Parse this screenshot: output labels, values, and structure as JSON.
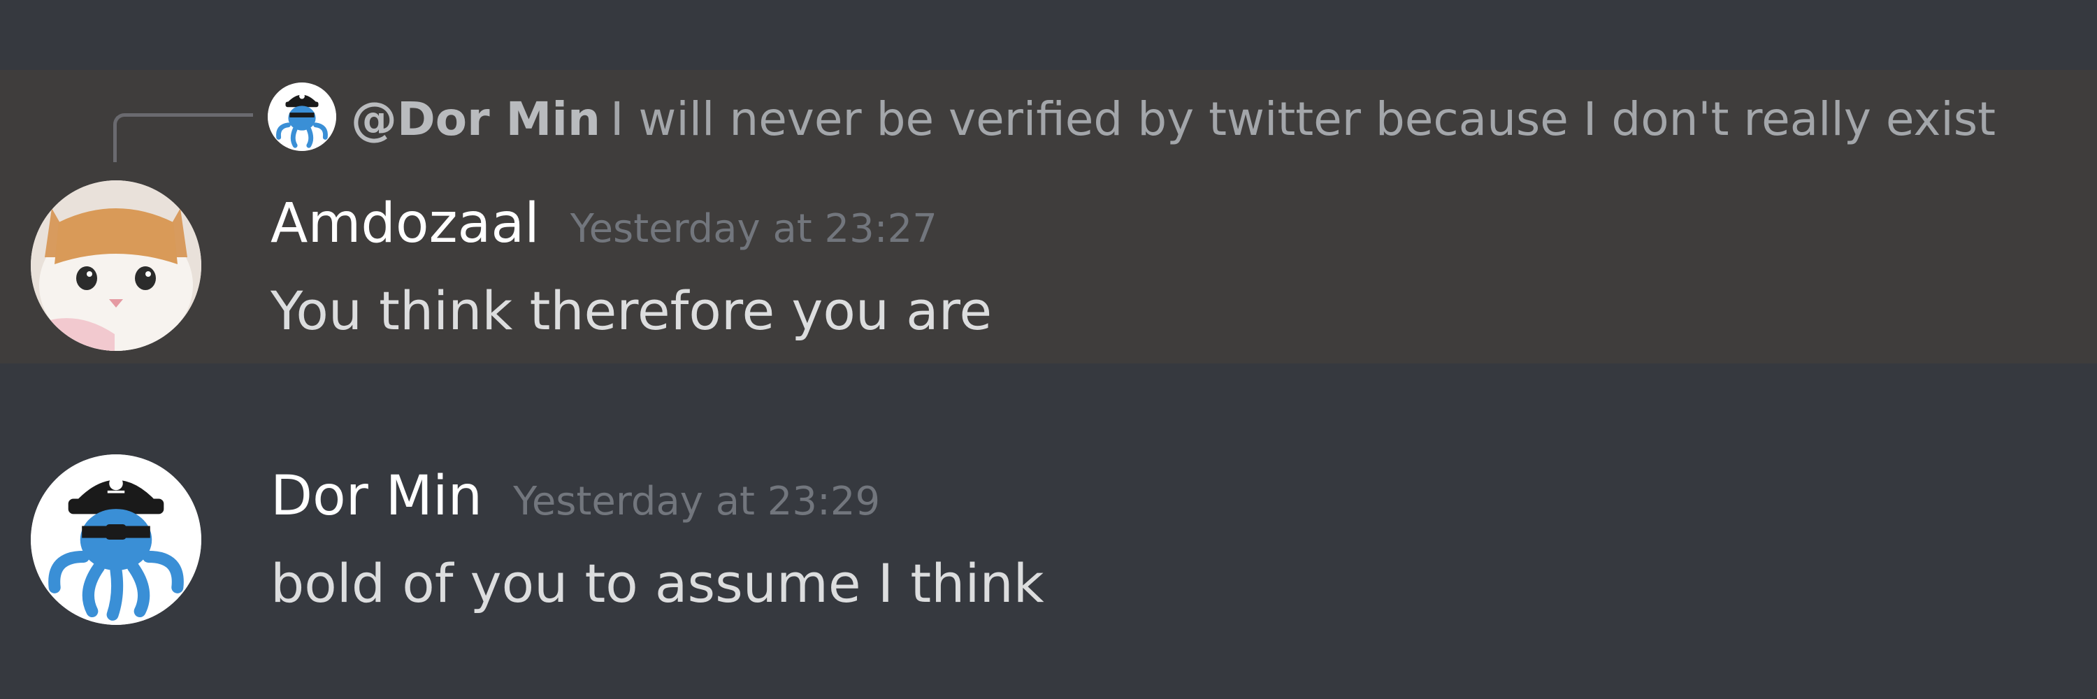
{
  "colors": {
    "background": "#36393f",
    "highlight": "#3f3d3c",
    "username": "#ffffff",
    "timestamp": "#72767d",
    "message_text": "#dcddde",
    "reply_author": "#b9bbbe",
    "reply_text": "#a3a6aa"
  },
  "reply": {
    "author": "@Dor Min",
    "text": "I will never be verified by twitter because I don't really exist",
    "avatar_icon": "pirate-octopus-avatar-icon"
  },
  "messages": [
    {
      "username": "Amdozaal",
      "timestamp": "Yesterday at 23:27",
      "content": "You think therefore you are",
      "avatar_icon": "cat-avatar-icon"
    },
    {
      "username": "Dor Min",
      "timestamp": "Yesterday at 23:29",
      "content": "bold of you to assume I think",
      "avatar_icon": "pirate-octopus-avatar-icon"
    }
  ]
}
